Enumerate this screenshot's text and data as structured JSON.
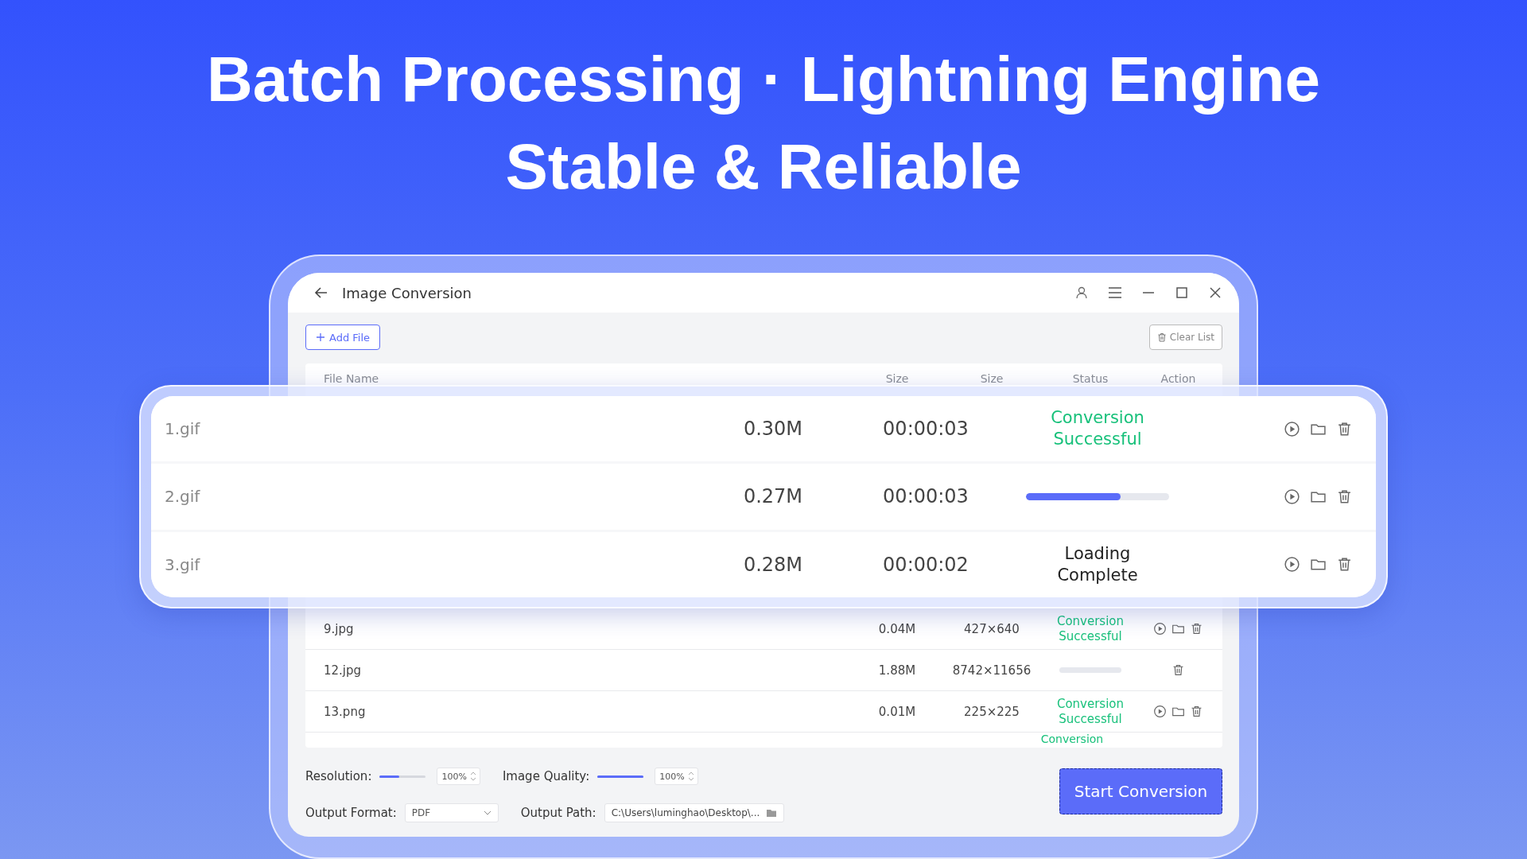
{
  "headline": [
    "Batch Processing · Lightning Engine",
    "Stable & Reliable"
  ],
  "window": {
    "title": "Image Conversion"
  },
  "toolbar": {
    "add_label": "Add File",
    "clear_label": "Clear List"
  },
  "table": {
    "columns": [
      "File Name",
      "Size",
      "Size",
      "Status",
      "Action"
    ],
    "rows": [
      {
        "name": "9.jpg",
        "size": "0.04M",
        "detail": "427×640",
        "status": {
          "kind": "success",
          "text": "Conversion Successful"
        },
        "open_enabled": true
      },
      {
        "name": "12.jpg",
        "size": "1.88M",
        "detail": "8742×11656",
        "status": {
          "kind": "progress",
          "level": 0
        },
        "open_enabled": false
      },
      {
        "name": "13.png",
        "size": "0.01M",
        "detail": "225×225",
        "status": {
          "kind": "success",
          "text": "Conversion Successful"
        },
        "open_enabled": true
      }
    ],
    "cut_status": "Conversion"
  },
  "popup": {
    "rows": [
      {
        "name": "1.gif",
        "size": "0.30M",
        "detail": "00:00:03",
        "status": {
          "kind": "success",
          "text": "Conversion Successful"
        },
        "open_enabled": true
      },
      {
        "name": "2.gif",
        "size": "0.27M",
        "detail": "00:00:03",
        "status": {
          "kind": "progress",
          "level": 0.66
        },
        "open_enabled": true
      },
      {
        "name": "3.gif",
        "size": "0.28M",
        "detail": "00:00:02",
        "status": {
          "kind": "loading",
          "text": "Loading Complete"
        },
        "open_enabled": true
      }
    ]
  },
  "settings": {
    "resolution": {
      "label": "Resolution:",
      "level": 0.42,
      "value": "100%"
    },
    "quality": {
      "label": "Image Quality:",
      "level": 1,
      "value": "100%"
    },
    "output_format": {
      "label": "Output Format:",
      "value": "PDF"
    },
    "output_path": {
      "label": "Output Path:",
      "value": "C:\\Users\\luminghao\\Desktop\\..."
    }
  },
  "start_button": "Start Conversion"
}
